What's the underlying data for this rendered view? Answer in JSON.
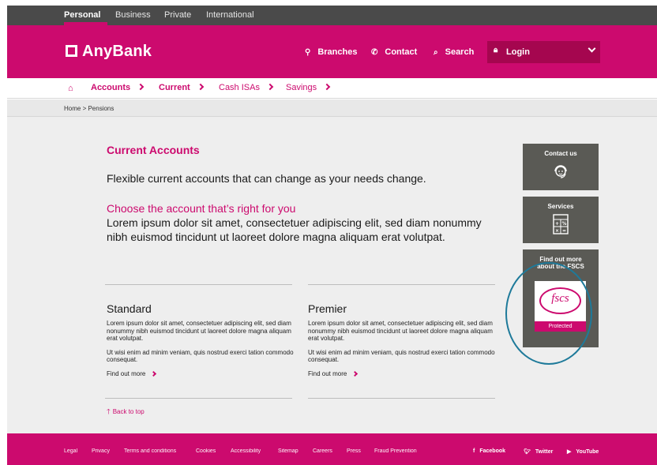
{
  "topbar": {
    "tabs": [
      "Personal",
      "Business",
      "Private",
      "International"
    ]
  },
  "header": {
    "logo": "AnyBank",
    "nav": [
      "Branches",
      "Contact",
      "Search"
    ],
    "login": "Login"
  },
  "subnav": {
    "items": [
      "Accounts",
      "Current",
      "Cash ISAs",
      "Savings"
    ]
  },
  "breadcrumb": "Home > Pensions",
  "content": {
    "title": "Current Accounts",
    "lead": "Flexible current accounts that can change as your needs change.",
    "subtitle": "Choose the account that’s right for you",
    "body": "Lorem ipsum dolor sit amet, consectetuer adipiscing elit, sed diam nonummy nibh euismod tincidunt ut laoreet dolore magna aliquam erat volutpat.",
    "columns": [
      {
        "title": "Standard",
        "p1": "Lorem ipsum dolor sit amet, consectetuer adipiscing elit, sed diam nonummy nibh euismod tincidunt ut laoreet dolore magna aliquam erat volutpat.",
        "p2": "Ut wisi enim ad minim veniam, quis nostrud exerci tation commodo consequat.",
        "more": "Find out more"
      },
      {
        "title": "Premier",
        "p1": "Lorem ipsum dolor sit amet, consectetuer adipiscing elit, sed diam nonummy nibh euismod tincidunt ut laoreet dolore magna aliquam erat volutpat.",
        "p2": "Ut wisi enim ad minim veniam, quis nostrud exerci tation commodo consequat.",
        "more": "Find out more"
      }
    ],
    "back_to_top": "Back to top"
  },
  "side": {
    "contact": "Contact us",
    "services": "Services",
    "fscs_title": "Find out more about the FSCS",
    "fscs_logo": "fscs",
    "fscs_protected": "Protected"
  },
  "footer": {
    "links": [
      "Legal",
      "Privacy",
      "Terms and conditions",
      "Cookies",
      "Accessibility",
      "Sitemap",
      "Careers",
      "Press",
      "Fraud Prevention"
    ],
    "social": [
      "Facebook",
      "Twitter",
      "YouTube"
    ]
  },
  "colors": {
    "brand": "#cc0a6e",
    "topbar": "#4a4a4a",
    "panel": "#5a5a55",
    "highlight_ring": "#1e7a9a"
  },
  "icons": [
    "home-icon",
    "location-pin-icon",
    "phone-icon",
    "search-icon",
    "lock-icon",
    "chevron-down-icon",
    "headset-icon",
    "calculator-icon",
    "arrow-up-icon",
    "facebook-icon",
    "twitter-icon",
    "youtube-icon"
  ]
}
